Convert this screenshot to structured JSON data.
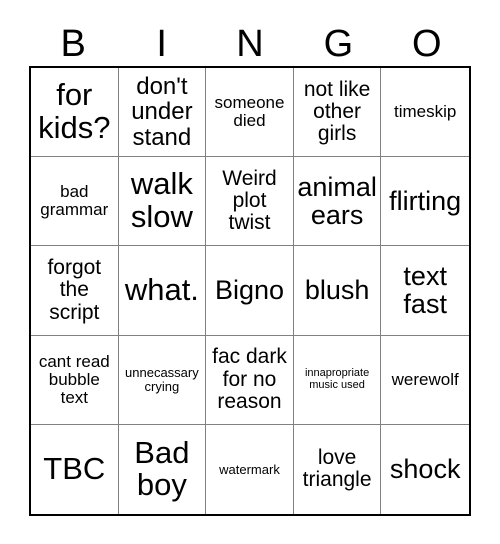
{
  "card": {
    "title": "BINGO",
    "headers": [
      "B",
      "I",
      "N",
      "G",
      "O"
    ],
    "rows": [
      [
        {
          "text": "for kids?",
          "size": "xxl"
        },
        {
          "text": "don't under stand",
          "size": "lg"
        },
        {
          "text": "someone died",
          "size": "sm"
        },
        {
          "text": "not like other girls",
          "size": "md"
        },
        {
          "text": "timeskip",
          "size": "sm"
        }
      ],
      [
        {
          "text": "bad grammar",
          "size": "sm"
        },
        {
          "text": "walk slow",
          "size": "xxl"
        },
        {
          "text": "Weird plot twist",
          "size": "md"
        },
        {
          "text": "animal ears",
          "size": "xl"
        },
        {
          "text": "flirting",
          "size": "xl"
        }
      ],
      [
        {
          "text": "forgot the script",
          "size": "md"
        },
        {
          "text": "what.",
          "size": "xxl"
        },
        {
          "text": "Bigno",
          "size": "xl"
        },
        {
          "text": "blush",
          "size": "xl"
        },
        {
          "text": "text fast",
          "size": "xl"
        }
      ],
      [
        {
          "text": "cant read bubble text",
          "size": "sm"
        },
        {
          "text": "unnecassary crying",
          "size": "xs"
        },
        {
          "text": "fac dark for no reason",
          "size": "md"
        },
        {
          "text": "innapropriate music used",
          "size": "xxs"
        },
        {
          "text": "werewolf",
          "size": "sm"
        }
      ],
      [
        {
          "text": "TBC",
          "size": "xxl"
        },
        {
          "text": "Bad boy",
          "size": "xxl"
        },
        {
          "text": "watermark",
          "size": "xs"
        },
        {
          "text": "love triangle",
          "size": "md"
        },
        {
          "text": "shock",
          "size": "xl"
        }
      ]
    ],
    "colors": {
      "background": "#ffffff",
      "text": "#000000",
      "outer_border": "#000000",
      "inner_grid_line": "#808080"
    }
  }
}
